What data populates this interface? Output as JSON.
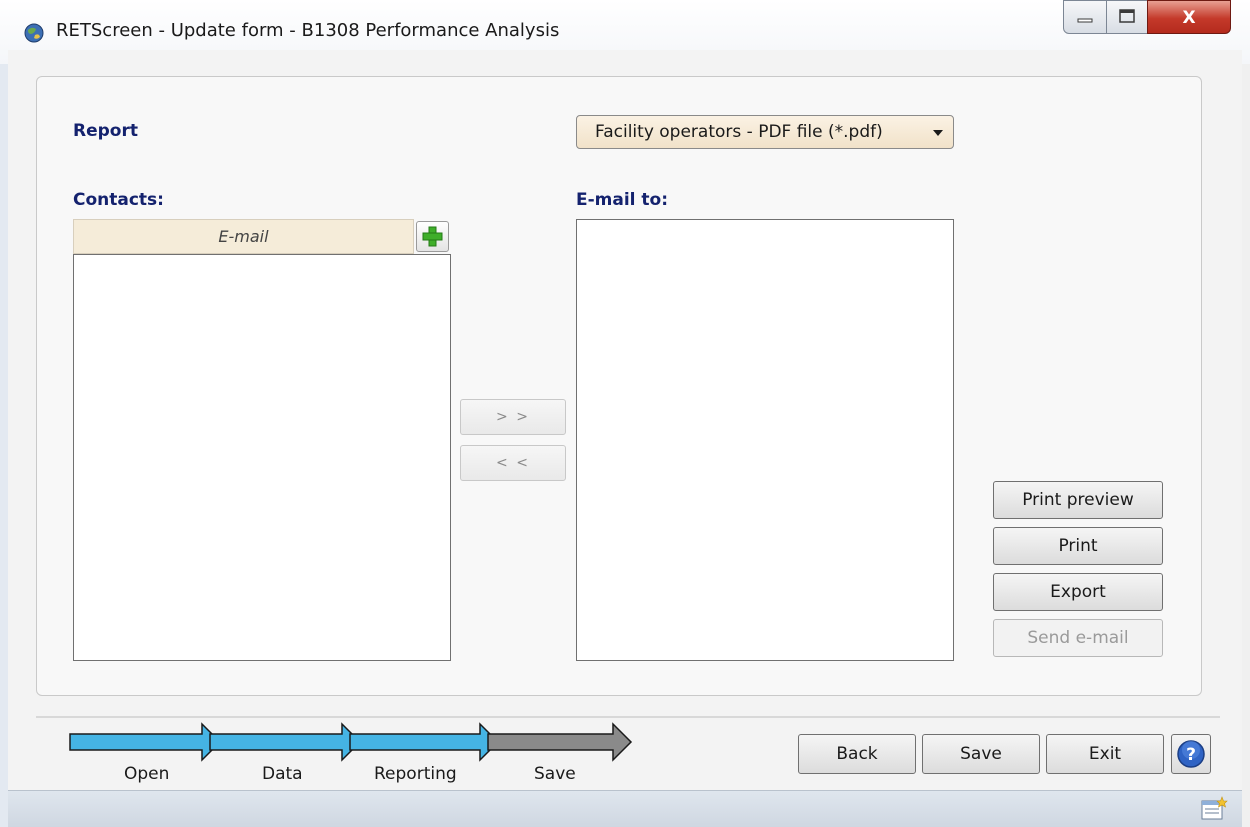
{
  "window": {
    "title": "RETScreen - Update form - B1308 Performance Analysis",
    "close_glyph": "X"
  },
  "report": {
    "label": "Report",
    "selected": "Facility operators - PDF file (*.pdf)"
  },
  "contacts": {
    "label": "Contacts:",
    "column_header": "E-mail"
  },
  "email_to": {
    "label": "E-mail to:"
  },
  "transfer": {
    "add_label": "> >",
    "remove_label": "< <"
  },
  "actions": {
    "print_preview": "Print preview",
    "print": "Print",
    "export": "Export",
    "send_email": "Send e-mail"
  },
  "workflow": {
    "steps": [
      "Open",
      "Data",
      "Reporting",
      "Save"
    ],
    "active_color": "#45b4e4",
    "inactive_color": "#8a8a8a"
  },
  "nav": {
    "back": "Back",
    "save": "Save",
    "exit": "Exit"
  },
  "colors": {
    "label": "#14226e",
    "dropdown_bg": "#f5ecd9"
  }
}
